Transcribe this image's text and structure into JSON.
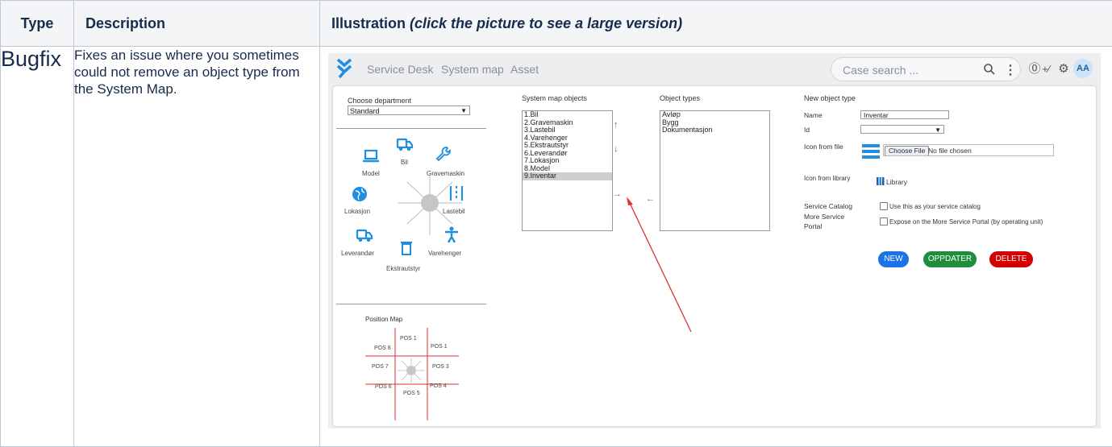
{
  "table": {
    "headers": {
      "type": "Type",
      "description": "Description",
      "illustration": "Illustration",
      "illustration_note": "(click the picture to see a large version)"
    },
    "row": {
      "type": "Bugfix",
      "description": "Fixes an issue where you sometimes could not remove an object type from the System Map."
    }
  },
  "app": {
    "nav": [
      "Service Desk",
      "System map",
      "Asset"
    ],
    "search_placeholder": "Case search ...",
    "avatar": "AA",
    "colors": {
      "accent": "#1f8de0",
      "new": "#1a73e8",
      "update": "#1e8e3e",
      "delete": "#d50000",
      "arrow": "#e23232"
    },
    "choose_department_label": "Choose department",
    "department_value": "Standard",
    "wheel": {
      "items": [
        "Bil",
        "Model",
        "Gravemaskin",
        "Lokasjon",
        "Lastebil",
        "Leverandør",
        "Varehenger",
        "Ekstrautstyr"
      ]
    },
    "position_map": {
      "title": "Position Map",
      "labels": [
        "POS 1",
        "POS 8",
        "POS 1",
        "POS 7",
        "POS 3",
        "POS 6",
        "POS 4",
        "POS 5"
      ]
    },
    "system_map_objects": {
      "label": "System map objects",
      "items": [
        "1.Bil",
        "2.Gravemaskin",
        "3.Lastebil",
        "4.Varehenger",
        "5.Ekstrautstyr",
        "6.Leverandør",
        "7.Lokasjon",
        "8.Model",
        "9.Inventar"
      ],
      "selected_index": 8
    },
    "object_types": {
      "label": "Object types",
      "items": [
        "Avløp",
        "Bygg",
        "Dokumentasjon"
      ]
    },
    "new_object_type": {
      "title": "New object type",
      "name_label": "Name",
      "name_value": "Inventar",
      "id_label": "Id",
      "icon_file_label": "Icon from file",
      "choose_file": "Choose File",
      "no_file": "No file chosen",
      "icon_library_label": "Icon from library",
      "library": "Library",
      "service_catalog_label": "Service Catalog",
      "service_catalog_text": "Use this as your service catalog",
      "more_portal_label": "More Service Portal",
      "more_portal_text": "Expose on the More Service Portal (by operating unit)",
      "buttons": {
        "new": "NEW",
        "update": "OPPDATER",
        "delete": "DELETE"
      }
    }
  }
}
